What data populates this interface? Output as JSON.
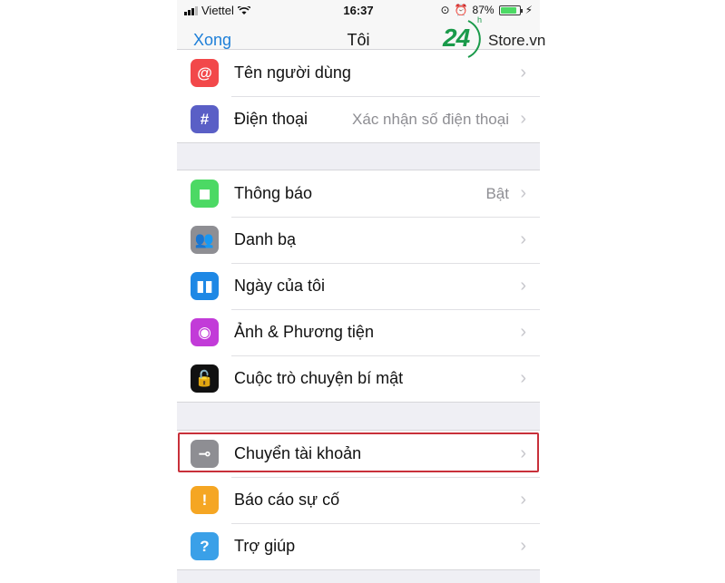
{
  "status_bar": {
    "carrier": "Viettel",
    "time": "16:37",
    "battery": "87%"
  },
  "nav": {
    "back_label": "Xong",
    "title": "Tôi"
  },
  "watermark": {
    "number": "24",
    "superscript": "h",
    "store": "Store.vn"
  },
  "groups": [
    {
      "rows": [
        {
          "label": "Tên người dùng",
          "value": "",
          "icon": "at-sign-icon",
          "color": "#f2484a"
        },
        {
          "label": "Điện thoại",
          "value": "Xác nhận số điện thoại",
          "icon": "hash-icon",
          "color": "#5a5fc6"
        }
      ]
    },
    {
      "rows": [
        {
          "label": "Thông báo",
          "value": "Bật",
          "icon": "notification-icon",
          "color": "#4cd964"
        },
        {
          "label": "Danh bạ",
          "value": "",
          "icon": "contacts-icon",
          "color": "#8e8e93"
        },
        {
          "label": "Ngày của tôi",
          "value": "",
          "icon": "my-day-icon",
          "color": "#1e88e5"
        },
        {
          "label": "Ảnh & Phương tiện",
          "value": "",
          "icon": "camera-icon",
          "color": "#c23bd8"
        },
        {
          "label": "Cuộc trò chuyện bí mật",
          "value": "",
          "icon": "lock-icon",
          "color": "#111111"
        }
      ]
    },
    {
      "rows": [
        {
          "label": "Chuyển tài khoản",
          "value": "",
          "icon": "key-icon",
          "color": "#8e8e93"
        },
        {
          "label": "Báo cáo sự cố",
          "value": "",
          "icon": "alert-icon",
          "color": "#f5a623"
        },
        {
          "label": "Trợ giúp",
          "value": "",
          "icon": "help-icon",
          "color": "#3aa0e8"
        }
      ]
    }
  ],
  "colors": {
    "accent": "#1e7fd8",
    "highlight_border": "#c8303a",
    "background": "#efeff4"
  }
}
